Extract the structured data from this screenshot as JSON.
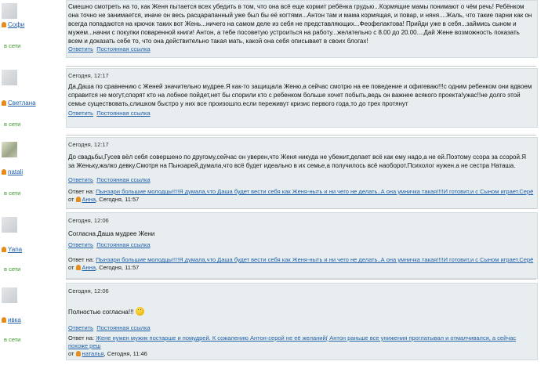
{
  "posts": [
    {
      "user": "Софи",
      "status": "в сети",
      "date": "",
      "text": "Смешно смотреть на то, как Женя пытается всех убедить в том, что она всё еще кормит ребёнка грудью...Кормящие мамы понимают о чём речь! Ребёнком она точно не занимается, иначе он весь расцарапанный уже был бы её когтями...Антон там и мама кормящая, и повар, и няня....Жаль, что такие парни как он всегда попадаются на крючок таких вот Жень...ничего на самом деле из себя не представляющих...Феофелактова! Прийди уже в себя...займись сыном и мужем...начни с покупки поваренной книги! Антон, а тебе посоветую устроиться на работу...желательно с 8.00 до 20.00....Дай Жене возможность показать всем и доказать себе то, что она действительно такая мать, какой она себя описывает в своих блогах!",
      "reply_label": "Ответить",
      "permalink_label": "Постоянная ссылка"
    },
    {
      "user": "Светлана",
      "status": "в сети",
      "date": "Сегодня, 12:17",
      "text": "Да,Даша по сравнению с Женей значительно мудрее.Я как-то защищала Женю,а сейчас смотрю на ее поведение и офигеваю!!!с одним ребенком они вдвоем справится не могут,спорят кто на лобное пойдет,нет бы спорили кто с ребенком больше хочет побыть,ведь он важнее всякого проекта!ужас!!не долго этой семье существовать,слишком быстро у них все произошло.если переживут кризис первого года,то до трех протянут",
      "reply_label": "Ответить",
      "permalink_label": "Постоянная ссылка"
    },
    {
      "user": "natali",
      "status": "в сети",
      "date": "Сегодня, 12:17",
      "text": "До свадьбы,Гусев вёл себя совершено по другому,сейчас он уверен,что Женя никуда не убежит,делает всё как ему надо,а не ей.Поэтому ссора за ссорой.Я за Женьку,жалко девку.Смотря на Пынзарей,думала,что всё будет идеально в их семье,а получилось всё наоборот.Психолог нужен.а не сестра Наташа.",
      "reply_prefix": "Ответ на:",
      "reply_text": "Пынзари большие молодцы!!!!Я думала,что Даша будет вести себя как Женя-ныть и ни чего не делать..А она умничка такая!!!!И готовит,и с Сыном играет.Серё",
      "reply_from": "от",
      "reply_author": "Анна",
      "reply_time": "Сегодня, 11:57",
      "reply_label": "Ответить",
      "permalink_label": "Постоянная ссылка"
    },
    {
      "user": "Yana",
      "status": "в сети",
      "date": "Сегодня, 12:06",
      "text": "Согласна.Даша мудрее Жени",
      "reply_prefix": "Ответ на:",
      "reply_text": "Пынзари большие молодцы!!!!Я думала,что Даша будет вести себя как Женя-ныть и ни чего не делать..А она умничка такая!!!!И готовит,и с Сыном играет.Серё",
      "reply_from": "от",
      "reply_author": "Анна",
      "reply_time": "Сегодня, 11:57",
      "reply_label": "Ответить",
      "permalink_label": "Постоянная ссылка"
    },
    {
      "user": "ивка",
      "status": "в сети",
      "date": "Сегодня, 12:06",
      "text": "Полностью согласна!!!",
      "reply_prefix": "Ответ на:",
      "reply_text": "Жене нужен мужик постарше и помудрей. К сожалению Антон-серой не её желаний( Антон раньше все унижения проглатывал и отмалчивался, а сейчас похоже реш",
      "reply_from": "от",
      "reply_author": "наталья",
      "reply_time": "Сегодня, 11:46",
      "reply_label": "Ответить",
      "permalink_label": "Постоянная ссылка"
    }
  ]
}
